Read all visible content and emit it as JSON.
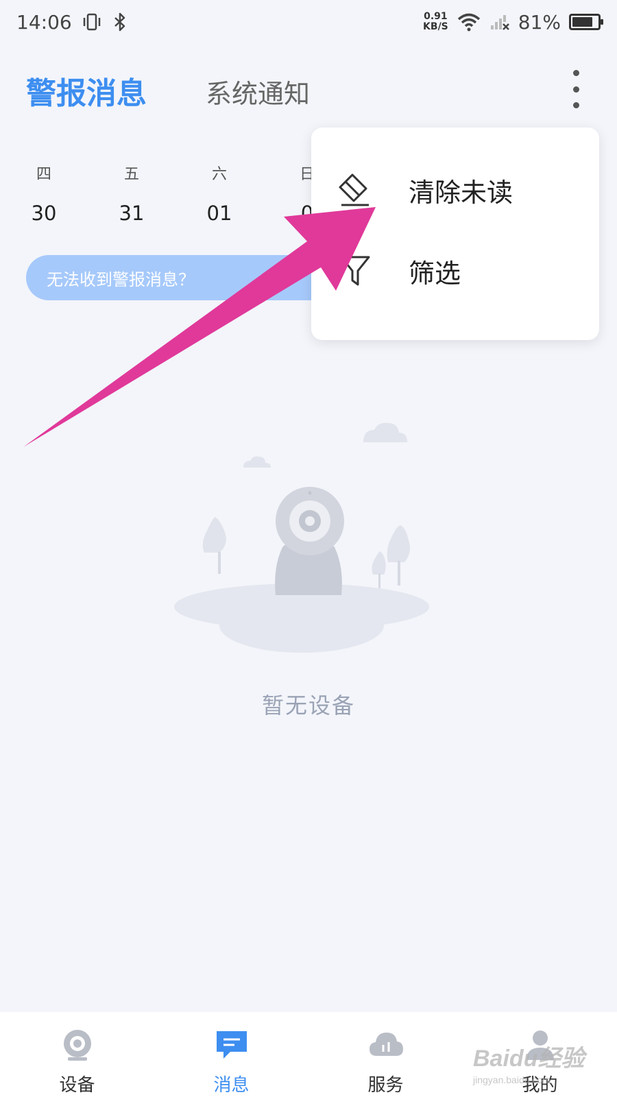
{
  "status_bar": {
    "time": "14:06",
    "net_speed_value": "0.91",
    "net_speed_unit": "KB/S",
    "battery": "81%",
    "battery_level": 0.81
  },
  "header": {
    "tab_alarm": "警报消息",
    "tab_system": "系统通知",
    "active_color": "#3d8ef0"
  },
  "calendar": {
    "days": [
      {
        "weekday": "四",
        "date": "30"
      },
      {
        "weekday": "五",
        "date": "31"
      },
      {
        "weekday": "六",
        "date": "01"
      },
      {
        "weekday": "日",
        "date": "0"
      }
    ]
  },
  "banner": {
    "text": "无法收到警报消息？"
  },
  "menu": {
    "items": [
      {
        "label": "清除未读",
        "icon": "eraser-icon"
      },
      {
        "label": "筛选",
        "icon": "filter-icon"
      }
    ]
  },
  "empty_state": {
    "text": "暂无设备"
  },
  "bottom_nav": {
    "items": [
      {
        "label": "设备",
        "icon": "camera-icon"
      },
      {
        "label": "消息",
        "icon": "message-icon"
      },
      {
        "label": "服务",
        "icon": "cloud-icon"
      },
      {
        "label": "我的",
        "icon": "user-icon"
      }
    ],
    "active": "消息"
  },
  "watermark": {
    "logo": "Baidu经验",
    "sub": "jingyan.baidu.com"
  },
  "annotation": {
    "arrow_color": "#e0399a"
  }
}
